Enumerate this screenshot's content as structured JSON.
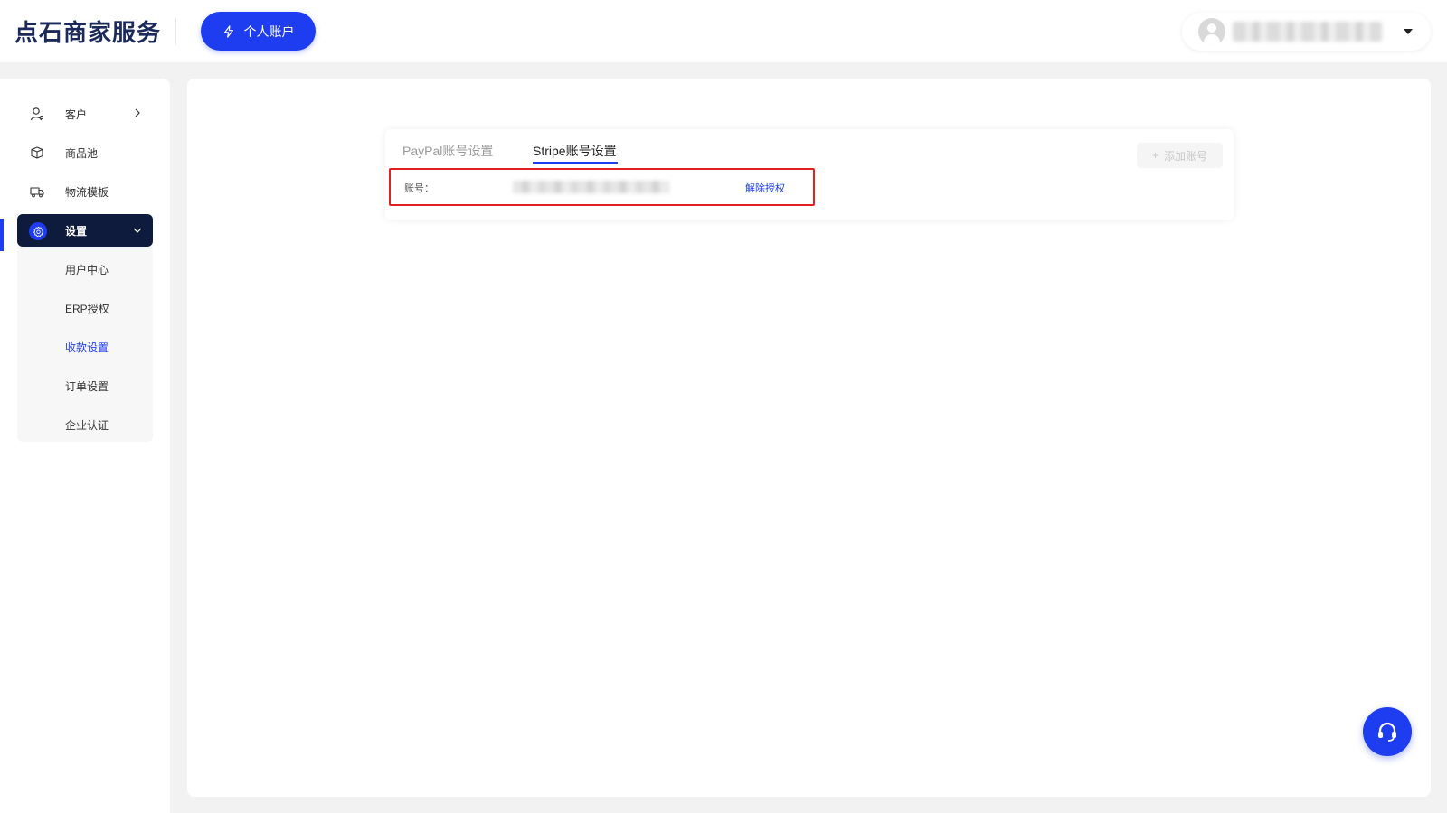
{
  "header": {
    "logo_text": "点石商家服务",
    "account_button_label": "个人账户",
    "user_dropdown_icon": "caret-down-icon"
  },
  "sidebar": {
    "items": [
      {
        "label": "客户",
        "icon": "user-icon"
      },
      {
        "label": "商品池",
        "icon": "box-icon"
      },
      {
        "label": "物流模板",
        "icon": "truck-icon"
      },
      {
        "label": "设置",
        "icon": "gear-icon"
      }
    ],
    "submenu": [
      {
        "label": "用户中心"
      },
      {
        "label": "ERP授权"
      },
      {
        "label": "收款设置"
      },
      {
        "label": "订单设置"
      },
      {
        "label": "企业认证"
      }
    ]
  },
  "main": {
    "tabs": [
      {
        "label": "PayPal账号设置"
      },
      {
        "label": "Stripe账号设置"
      }
    ],
    "add_button_label": "添加账号",
    "account_label": "账号：",
    "unauthorize_link": "解除授权"
  },
  "colors": {
    "accent": "#1f3df0",
    "sidebar_active_bg": "#0e1b3d",
    "highlight_border": "#e32020"
  }
}
